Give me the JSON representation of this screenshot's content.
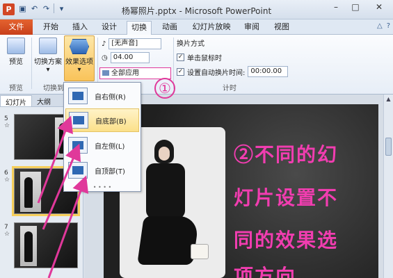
{
  "app": {
    "logo": "P",
    "title": "杨幂照片.pptx - Microsoft PowerPoint"
  },
  "qat": {
    "save_icon": "save-icon",
    "undo_icon": "undo-icon",
    "redo_icon": "redo-icon",
    "customize_icon": "customize-qat-icon"
  },
  "window_controls": {
    "minimize": "–",
    "maximize": "□",
    "close": "✕"
  },
  "tabs": [
    {
      "label": "文件"
    },
    {
      "label": "开始"
    },
    {
      "label": "插入"
    },
    {
      "label": "设计"
    },
    {
      "label": "切换"
    },
    {
      "label": "动画"
    },
    {
      "label": "幻灯片放映"
    },
    {
      "label": "审阅"
    },
    {
      "label": "视图"
    }
  ],
  "ribbon": {
    "preview_label": "预览",
    "scheme_label": "切换方案",
    "effect_label": "效果选项",
    "preview_group": "预览",
    "transition_group": "切换到此",
    "sound_value": "[无声音]",
    "duration_value": "04.00",
    "apply_all_label": "全部应用",
    "switch_mode_label": "换片方式",
    "on_click_label": "单击鼠标时",
    "after_label": "设置自动换片时间:",
    "after_value": "00:00.00",
    "timing_group": "计时"
  },
  "panel": {
    "tab_slides": "幻灯片",
    "tab_outline": "大纲",
    "close": "×",
    "slides": [
      {
        "num": "5"
      },
      {
        "num": "6"
      },
      {
        "num": "7"
      }
    ]
  },
  "dropdown": {
    "items": [
      {
        "label": "自右侧(R)"
      },
      {
        "label": "自底部(B)"
      },
      {
        "label": "自左侧(L)"
      },
      {
        "label": "自顶部(T)"
      }
    ]
  },
  "annotation": {
    "circle_one": "①"
  },
  "slide": {
    "lines": [
      "②不同的幻",
      "灯片设置不",
      "同的效果选",
      "项方向"
    ]
  },
  "colors": {
    "accent": "#e0389a",
    "file_tab": "#d24625",
    "hover": "#fbe08a"
  }
}
